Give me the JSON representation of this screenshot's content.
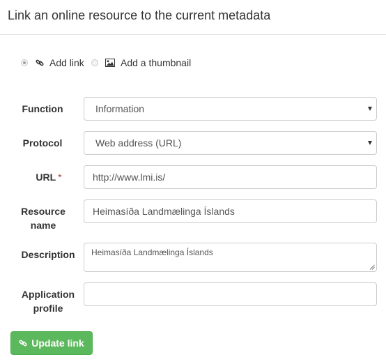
{
  "header": {
    "title": "Link an online resource to the current metadata"
  },
  "mode": {
    "options": [
      {
        "label": "Add link",
        "icon": "link-icon",
        "selected": true
      },
      {
        "label": "Add a thumbnail",
        "icon": "picture-icon",
        "selected": false
      }
    ]
  },
  "form": {
    "function": {
      "label": "Function",
      "value": "Information"
    },
    "protocol": {
      "label": "Protocol",
      "value": "Web address (URL)"
    },
    "url": {
      "label": "URL",
      "required_mark": "*",
      "value": "http://www.lmi.is/"
    },
    "resource_name": {
      "label_line1": "Resource",
      "label_line2": "name",
      "value": "Heimasíða Landmælinga Íslands"
    },
    "description": {
      "label": "Description",
      "value": "Heimasíða Landmælinga Íslands"
    },
    "application_profile": {
      "label_line1": "Application",
      "label_line2": "profile",
      "value": ""
    }
  },
  "actions": {
    "submit_label": "Update link",
    "submit_icon": "link-icon"
  },
  "colors": {
    "primary_button": "#5cb85c",
    "required_mark": "#a94442"
  }
}
